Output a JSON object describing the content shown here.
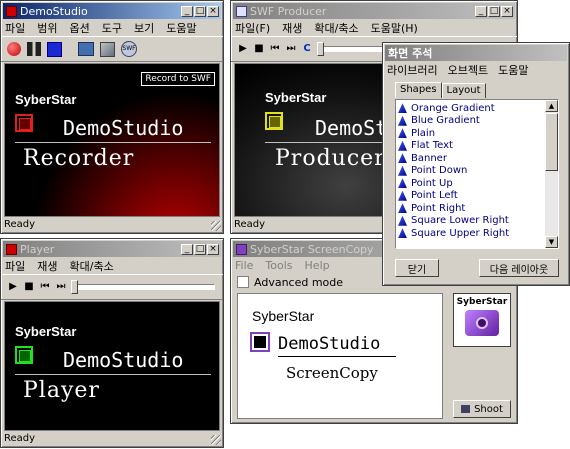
{
  "recorder": {
    "title": "DemoStudio",
    "menu": [
      "파일",
      "범위",
      "옵션",
      "도구",
      "보기",
      "도움말"
    ],
    "tooltip": "Record to SWF",
    "brand": "SyberStar",
    "product": "DemoStudio",
    "name": "Recorder",
    "status": "Ready"
  },
  "producer": {
    "title": "SWF Producer",
    "menu": [
      "파일(F)",
      "재생",
      "확대/축소",
      "도움말(H)"
    ],
    "brand": "SyberStar",
    "product": "DemoStudio",
    "name": "Producer",
    "status": "Ready"
  },
  "player": {
    "title": "Player",
    "menu": [
      "파일",
      "재생",
      "확대/축소"
    ],
    "brand": "SyberStar",
    "product": "DemoStudio",
    "name": "Player",
    "status": "Ready"
  },
  "screencopy": {
    "title": "SyberStar ScreenCopy",
    "menu": [
      "File",
      "Tools",
      "Help"
    ],
    "checkbox_label": "Advanced mode",
    "brand": "SyberStar",
    "product": "DemoStudio",
    "name": "ScreenCopy",
    "badge_label": "SyberStar",
    "shoot_label": "Shoot"
  },
  "annotation": {
    "title": "화면 주석",
    "menu": [
      "라이브러리",
      "오브젝트",
      "도움말"
    ],
    "tabs": [
      "Shapes",
      "Layout"
    ],
    "items": [
      "Orange Gradient",
      "Blue Gradient",
      "Plain",
      "Flat Text",
      "Banner",
      "Point Down",
      "Point Up",
      "Point Left",
      "Point Right",
      "Square Lower Right",
      "Square Upper Right"
    ],
    "close_label": "닫기",
    "next_label": "다음 레이아웃"
  }
}
